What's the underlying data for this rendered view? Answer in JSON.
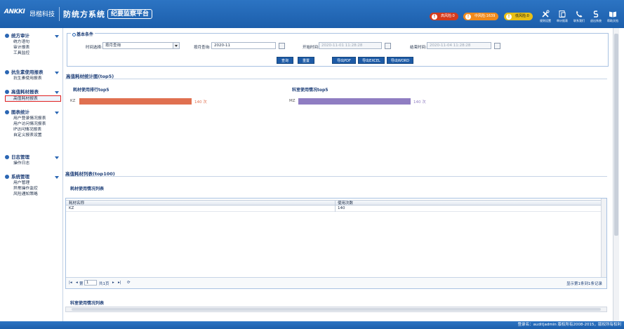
{
  "header": {
    "logo": "ANKKI",
    "company": "昂楷科技",
    "system_title": "防统方系统",
    "platform_badge": "纪要监察平台",
    "risk": {
      "high": {
        "label": "高风险:0",
        "color": "#d43a1c"
      },
      "mid": {
        "label": "中风险:1639",
        "color": "#f08a1c"
      },
      "low": {
        "label": "低风险:0",
        "color": "#e8bf16"
      }
    },
    "tools": [
      {
        "icon": "tools-icon",
        "label": "规则设置"
      },
      {
        "icon": "report-icon",
        "label": "审计报表"
      },
      {
        "icon": "phone-icon",
        "label": "联系我们"
      },
      {
        "icon": "logout-icon",
        "label": "退出系统"
      },
      {
        "icon": "book-icon",
        "label": "帮助文档"
      }
    ]
  },
  "sidebar": {
    "groups": [
      {
        "title": "统方审计",
        "items": [
          "统方语句",
          "审计报表",
          "工具监控"
        ]
      },
      {
        "title": "抗生素使用报表",
        "items": [
          "抗生素使用报表"
        ]
      },
      {
        "title": "高值耗材报表",
        "items": [
          "高值耗材报表"
        ]
      },
      {
        "title": "图表统计",
        "items": [
          "用户登录情况报表",
          "用户访问情况报表",
          "IP访问情况报表",
          "自定义报表设置"
        ]
      },
      {
        "title": "日志管理",
        "items": [
          "操作日志"
        ]
      },
      {
        "title": "系统管理",
        "items": [
          "用户管理",
          "异常操作监控",
          "风险通知策略"
        ]
      }
    ],
    "active_item": "高值耗材报表"
  },
  "filters": {
    "legend": "基本条件",
    "time_choice_label": "时间选择:",
    "time_choice_value": "按月查询",
    "month_label": "按月查询:",
    "month_value": "2020-11",
    "start_label": "开始时间:",
    "start_value": "2020-11-01 11:28:28",
    "end_label": "结束时间:",
    "end_value": "2020-11-04 11:28:28"
  },
  "buttons": {
    "query": "查询",
    "reset": "重置",
    "export_pdf": "导出PDF",
    "export_excel": "导出EXCEL",
    "export_word": "导出WORD"
  },
  "stats_section": {
    "title": "高值耗材统计图(top5)"
  },
  "chart_data": [
    {
      "type": "bar",
      "title": "耗材使用排行top5",
      "categories": [
        "KZ"
      ],
      "values": [
        140
      ],
      "unit": "次",
      "color": "#e07050"
    },
    {
      "type": "bar",
      "title": "科室使用情况top5",
      "categories": [
        "MZ"
      ],
      "values": [
        140
      ],
      "unit": "次",
      "color": "#8f7dc2"
    }
  ],
  "list_section": {
    "title": "高值耗材列表(top100)",
    "subtitle": "耗材使用情况列表",
    "columns": [
      "耗材名称",
      "使用次数"
    ],
    "rows": [
      [
        "KZ",
        "140"
      ]
    ],
    "pager": {
      "page_label": "第",
      "page": "1",
      "of": "共1页",
      "info": "显示第1条到1条记录"
    },
    "next_title": "科室使用情况列表"
  },
  "footer": {
    "text": "登录名：audit|admin 版权所有2008-2015，版权所有权利"
  }
}
